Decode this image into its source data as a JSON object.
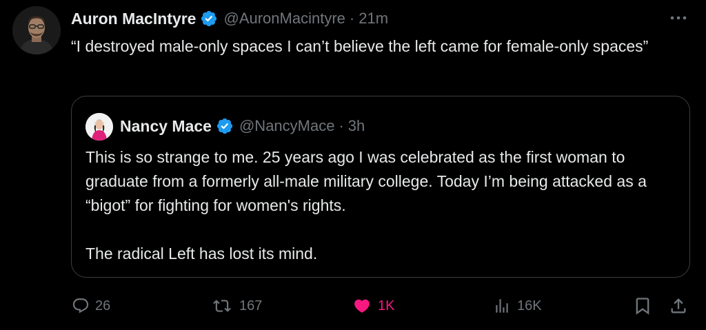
{
  "tweet": {
    "author_name": "Auron MacIntyre",
    "author_handle": "@AuronMacintyre",
    "separator": "·",
    "time": "21m",
    "text": "“I destroyed male-only spaces I can’t believe the left came for female-only spaces”"
  },
  "quote": {
    "author_name": "Nancy Mace",
    "author_handle": "@NancyMace",
    "separator": "·",
    "time": "3h",
    "paragraphs": [
      "This is so strange to me. 25 years ago I was celebrated as the first woman to graduate from a formerly all-male military college. Today I’m being attacked as a “bigot” for fighting for women's rights.",
      "The radical Left has lost its mind."
    ]
  },
  "actions": {
    "replies": "26",
    "reposts": "167",
    "likes": "1K",
    "views": "16K"
  },
  "colors": {
    "background": "#000000",
    "text": "#e7e9ea",
    "muted": "#71767b",
    "verified": "#1d9bf0",
    "like": "#f91880",
    "border": "#3b3e42"
  },
  "icons": [
    "verified-badge-icon",
    "more-icon",
    "reply-icon",
    "repost-icon",
    "like-icon",
    "views-icon",
    "bookmark-icon",
    "share-icon"
  ]
}
